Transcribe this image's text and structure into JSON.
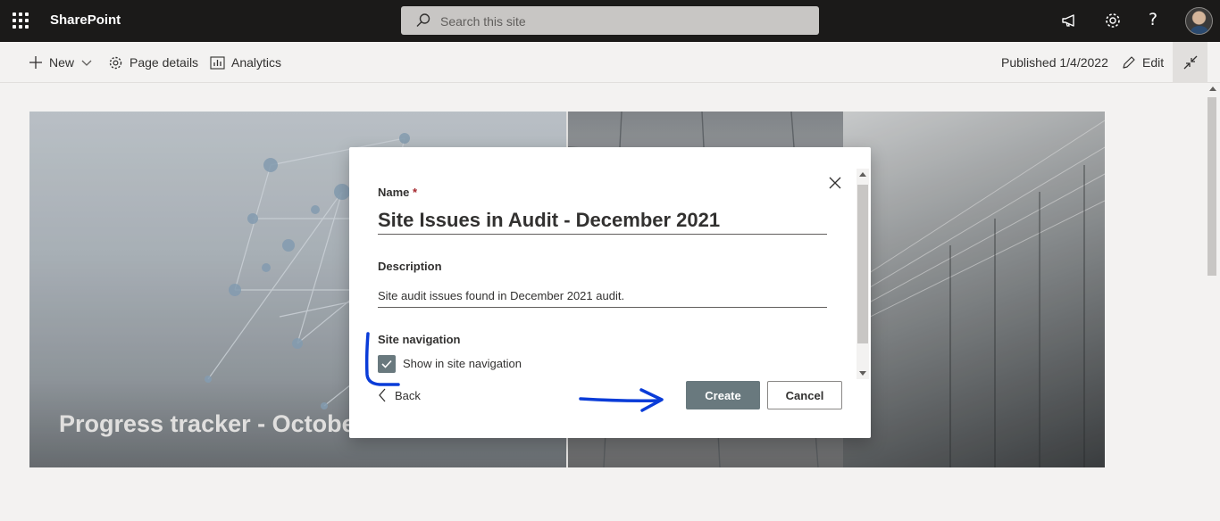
{
  "suite_bar": {
    "app_name": "SharePoint",
    "search_placeholder": "Search this site"
  },
  "command_bar": {
    "new_label": "New",
    "page_details_label": "Page details",
    "analytics_label": "Analytics",
    "published_label": "Published 1/4/2022",
    "edit_label": "Edit"
  },
  "hero": {
    "title": "Progress tracker - October"
  },
  "dialog": {
    "name_label": "Name",
    "required_marker": "*",
    "name_value": "Site Issues in Audit - December 2021",
    "description_label": "Description",
    "description_value": "Site audit issues found in December 2021 audit.",
    "site_navigation_label": "Site navigation",
    "show_in_nav_label": "Show in site navigation",
    "show_in_nav_checked": true,
    "back_label": "Back",
    "create_label": "Create",
    "cancel_label": "Cancel"
  },
  "colors": {
    "suite_bar": "#1b1a19",
    "primary_button": "#69797e",
    "annotation_ink": "#0a3cd8"
  },
  "icons": [
    "waffle-icon",
    "search-icon",
    "megaphone-icon",
    "gear-icon",
    "help-icon",
    "plus-icon",
    "chevron-down-icon",
    "gear-icon",
    "chart-icon",
    "pencil-icon",
    "collapse-icon",
    "close-icon",
    "check-icon",
    "chevron-left-icon"
  ]
}
